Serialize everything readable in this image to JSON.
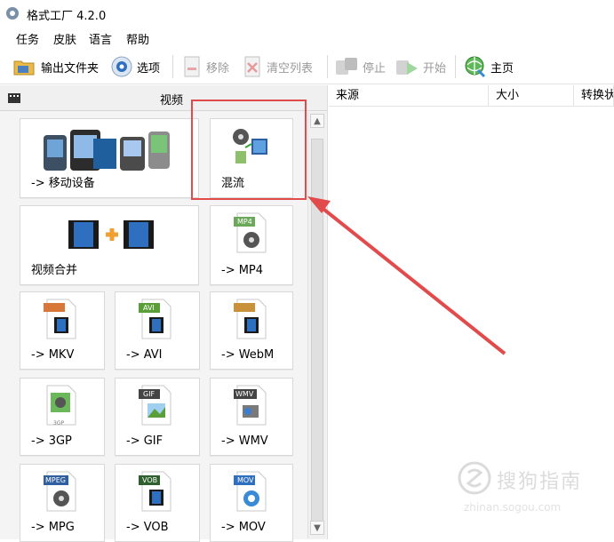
{
  "window": {
    "title": "格式工厂 4.2.0"
  },
  "menu": [
    "任务",
    "皮肤",
    "语言",
    "帮助"
  ],
  "toolbar": {
    "output_folder": "输出文件夹",
    "options": "选项",
    "remove": "移除",
    "clear_list": "清空列表",
    "stop": "停止",
    "start": "开始",
    "home": "主页"
  },
  "left_panel": {
    "header": "视频"
  },
  "tiles": {
    "mobile": "-> 移动设备",
    "mux": "混流",
    "merge": "视频合并",
    "mp4": "-> MP4",
    "mkv": "-> MKV",
    "avi": "-> AVI",
    "webm": "-> WebM",
    "3gp": "-> 3GP",
    "gif": "-> GIF",
    "wmv": "-> WMV",
    "mpg": "-> MPG",
    "vob": "-> VOB",
    "mov": "-> MOV"
  },
  "badges": {
    "mp4": "MP4",
    "avi": "AVI",
    "gif": "GIF",
    "wmv": "WMV",
    "mpeg": "MPEG",
    "vob": "VOB",
    "mov": "MOV",
    "3gp": "3GP"
  },
  "task_list": {
    "columns": [
      "来源",
      "大小",
      "转换状"
    ]
  },
  "watermark": {
    "brand": "搜狗指南",
    "url": "zhinan.sogou.com"
  },
  "colors": {
    "highlight": "#e24b4b",
    "arrow": "#e24b4b"
  }
}
